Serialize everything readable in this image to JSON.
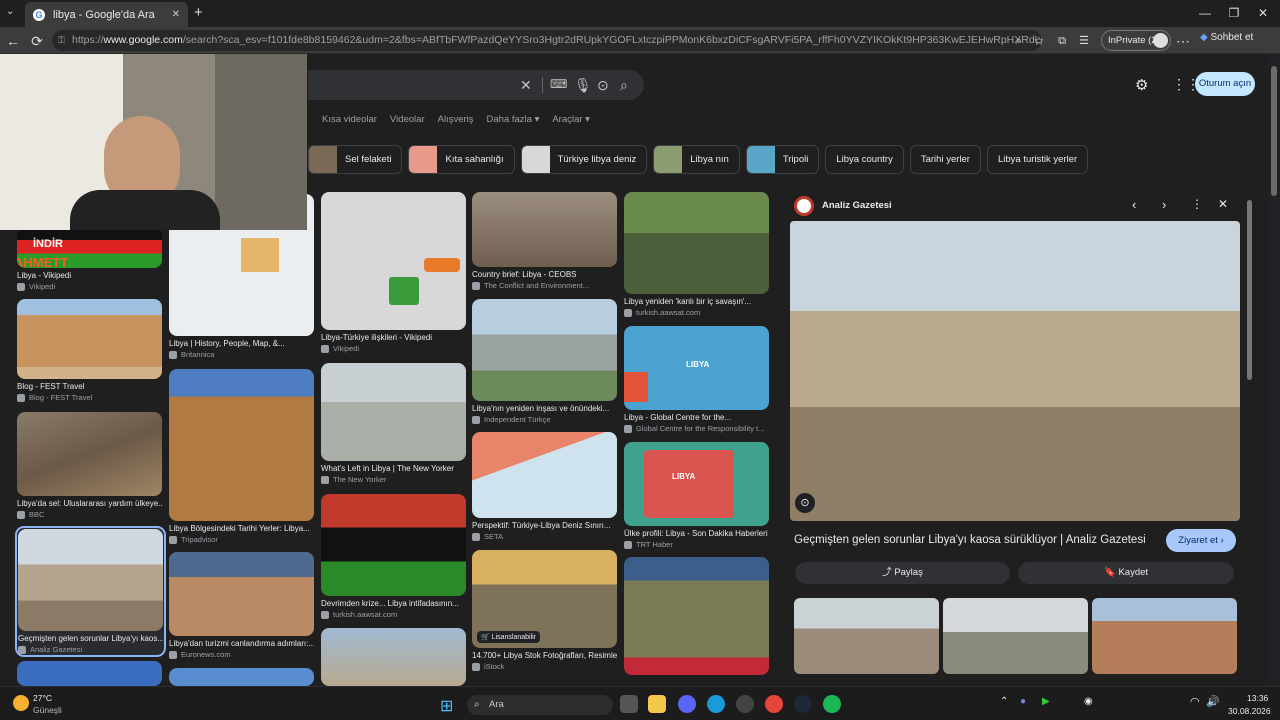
{
  "browser": {
    "tab_title": "libya - Google'da Ara",
    "url_prefix": "https://",
    "url_host": "www.google.com",
    "url_rest": "/search?sca_esv=f101fde8b8159462&udm=2&fbs=ABfTbFWfPazdQeYYSro3Hgtr2dRUpkYGOFLxtczpiPPMonK6bxzDiCFsgARVFi5PA_rffFh0YVZYIKOkKt9HP363KwEJEHwRpHXRdLiICvcwkD-gsUnJm8gKwv...",
    "inprivate_label": "InPrivate (2)",
    "sohbet_label": "Sohbet et"
  },
  "google": {
    "nav_tabs": [
      "Kısa videolar",
      "Videolar",
      "Alışveriş",
      "Daha fazla ▾",
      "Araçlar ▾"
    ],
    "signin_label": "Oturum açın",
    "chips": [
      {
        "label": "Sel felaketi",
        "color": "#7a6a55"
      },
      {
        "label": "Kıta sahanlığı",
        "color": "#e89a8a"
      },
      {
        "label": "Türkiye libya deniz",
        "color": "#d8d8d8"
      },
      {
        "label": "Libya nın",
        "color": "#8a9c70"
      },
      {
        "label": "Tripoli",
        "color": "#5aa6c8"
      },
      {
        "label": "Libya country",
        "color": ""
      },
      {
        "label": "Tarihi yerler",
        "color": ""
      },
      {
        "label": "Libya turistik yerler",
        "color": ""
      }
    ]
  },
  "results": [
    {
      "caption": "Libya - Vikipedi",
      "source": "Vikipedi"
    },
    {
      "caption": "Blog - FEST Travel",
      "source": "Blog - FEST Travel"
    },
    {
      "caption": "Libya'da sel: Uluslararası yardım ülkeye...",
      "source": "BBC"
    },
    {
      "caption": "Geçmişten gelen sorunlar Libya'yı kaos...",
      "source": "Analiz Gazetesi"
    },
    {
      "caption": "Libya | History, People, Map, &...",
      "source": "Britannica"
    },
    {
      "caption": "Libya Bölgesindeki Tarihi Yerler: Libya...",
      "source": "Tripadvisor"
    },
    {
      "caption": "Libya'dan turizmi canlandırma adımları:...",
      "source": "Euronews.com"
    },
    {
      "caption": "Libya-Türkiye ilişkileri - Vikipedi",
      "source": "Vikipedi"
    },
    {
      "caption": "What's Left in Libya | The New Yorker",
      "source": "The New Yorker"
    },
    {
      "caption": "Devrimden krize... Libya intifadasının...",
      "source": "turkish.aawsat.com"
    },
    {
      "caption": "Country brief: Libya - CEOBS",
      "source": "The Conflict and Environment..."
    },
    {
      "caption": "Libya'nın yeniden inşası ve önündeki...",
      "source": "Independent Türkçe"
    },
    {
      "caption": "Perspektif: Türkiye-Libya Deniz Sınırı...",
      "source": "SETA"
    },
    {
      "caption": "14.700+ Libya Stok Fotoğrafları, Resimle...",
      "source": "iStock"
    },
    {
      "caption": "Libya yeniden 'kanlı bir iç savaşın'...",
      "source": "turkish.aawsat.com"
    },
    {
      "caption": "Libya - Global Centre for the...",
      "source": "Global Centre for the Responsibility t..."
    },
    {
      "caption": "Ülke profili: Libya - Son Dakika Haberleri",
      "source": "TRT Haber"
    }
  ],
  "overlay": {
    "flag_text": "İNDİR",
    "name_text": "AHMETT",
    "license_label": "Lisanslanabilir",
    "map_label_libya": "LIBYA"
  },
  "panel": {
    "source": "Analiz Gazetesi",
    "title": "Geçmişten gelen sorunlar Libya'yı kaosa sürüklüyor | Analiz Gazetesi",
    "visit_label": "Ziyaret et ›",
    "share_label": "Paylaş",
    "save_label": "Kaydet"
  },
  "taskbar": {
    "temp": "27°C",
    "weather": "Güneşli",
    "search_label": "Ara",
    "time": "13:36",
    "date": "30.08.2026"
  }
}
